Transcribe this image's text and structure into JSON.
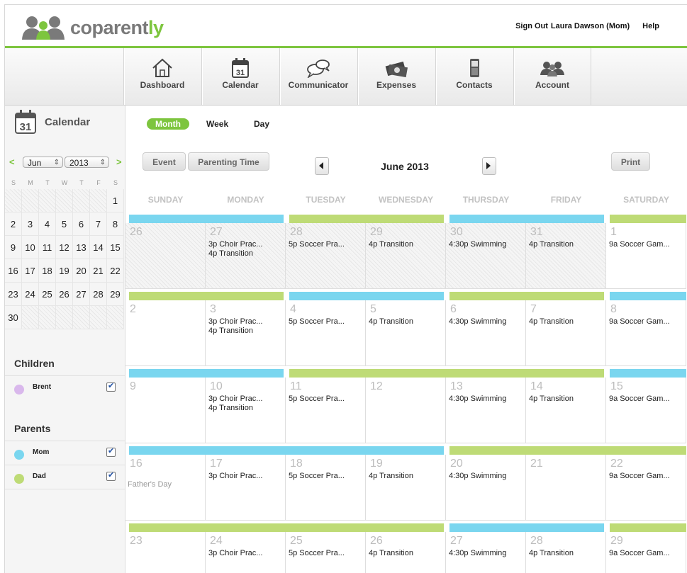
{
  "brand": {
    "name_main": "coparent",
    "name_accent": "ly",
    "colors": {
      "green": "#7dc53e",
      "blue": "#7ad6ef",
      "lime": "#bedb76",
      "purple": "#d9b8ec",
      "gray": "#7a7a7a"
    }
  },
  "header": {
    "sign_out": "Sign Out",
    "user": "Laura Dawson (Mom)",
    "help": "Help"
  },
  "nav": [
    {
      "label": "Dashboard",
      "icon": "house-icon"
    },
    {
      "label": "Calendar",
      "icon": "calendar-icon",
      "icon_text": "31"
    },
    {
      "label": "Communicator",
      "icon": "speech-bubbles-icon"
    },
    {
      "label": "Expenses",
      "icon": "money-icon"
    },
    {
      "label": "Contacts",
      "icon": "phone-icon"
    },
    {
      "label": "Account",
      "icon": "people-icon"
    }
  ],
  "sidebar": {
    "title": "Calendar",
    "icon_text": "31",
    "prev": "<",
    "next": ">",
    "month_select": "Jun",
    "year_select": "2013",
    "dow": [
      "S",
      "M",
      "T",
      "W",
      "T",
      "F",
      "S"
    ],
    "days": [
      "",
      "",
      "",
      "",
      "",
      "",
      "1",
      "2",
      "3",
      "4",
      "5",
      "6",
      "7",
      "8",
      "9",
      "10",
      "11",
      "12",
      "13",
      "14",
      "15",
      "16",
      "17",
      "18",
      "19",
      "20",
      "21",
      "22",
      "23",
      "24",
      "25",
      "26",
      "27",
      "28",
      "29",
      "30",
      "",
      "",
      "",
      "",
      "",
      ""
    ],
    "children_heading": "Children",
    "children": [
      {
        "name": "Brent",
        "color": "#d9b8ec",
        "checked": true
      }
    ],
    "parents_heading": "Parents",
    "parents": [
      {
        "name": "Mom",
        "color": "#7ad6ef",
        "checked": true
      },
      {
        "name": "Dad",
        "color": "#bedb76",
        "checked": true
      }
    ]
  },
  "calendar": {
    "tabs": [
      "Month",
      "Week",
      "Day"
    ],
    "active_tab": "Month",
    "event_button": "Event",
    "parenting_time_button": "Parenting Time",
    "print_button": "Print",
    "month_title": "June 2013",
    "days_of_week": [
      "SUNDAY",
      "MONDAY",
      "TUESDAY",
      "WEDNESDAY",
      "THURSDAY",
      "FRIDAY",
      "SATURDAY"
    ],
    "weeks": [
      {
        "bars": [
          {
            "from": 0,
            "to": 1,
            "parent": "mom"
          },
          {
            "from": 2,
            "to": 3,
            "parent": "dad"
          },
          {
            "from": 4,
            "to": 5,
            "parent": "mom"
          },
          {
            "from": 6,
            "to": 6,
            "parent": "dad"
          }
        ],
        "days": [
          {
            "num": "26",
            "outside": true,
            "events": []
          },
          {
            "num": "27",
            "outside": true,
            "events": [
              "3p Choir Prac...",
              "4p Transition"
            ]
          },
          {
            "num": "28",
            "outside": true,
            "events": [
              "5p Soccer Pra..."
            ]
          },
          {
            "num": "29",
            "outside": true,
            "events": [
              "4p Transition"
            ]
          },
          {
            "num": "30",
            "outside": true,
            "events": [
              "4:30p Swimming"
            ]
          },
          {
            "num": "31",
            "outside": true,
            "events": [
              "4p Transition"
            ]
          },
          {
            "num": "1",
            "outside": false,
            "events": [
              "9a Soccer Gam..."
            ]
          }
        ]
      },
      {
        "bars": [
          {
            "from": 0,
            "to": 1,
            "parent": "dad"
          },
          {
            "from": 2,
            "to": 3,
            "parent": "mom"
          },
          {
            "from": 4,
            "to": 5,
            "parent": "dad"
          },
          {
            "from": 6,
            "to": 6,
            "parent": "mom"
          }
        ],
        "days": [
          {
            "num": "2",
            "events": []
          },
          {
            "num": "3",
            "events": [
              "3p Choir Prac...",
              "4p Transition"
            ]
          },
          {
            "num": "4",
            "events": [
              "5p Soccer Pra..."
            ]
          },
          {
            "num": "5",
            "events": [
              "4p Transition"
            ]
          },
          {
            "num": "6",
            "events": [
              "4:30p Swimming"
            ]
          },
          {
            "num": "7",
            "events": [
              "4p Transition"
            ]
          },
          {
            "num": "8",
            "events": [
              "9a Soccer Gam..."
            ]
          }
        ]
      },
      {
        "bars": [
          {
            "from": 0,
            "to": 1,
            "parent": "mom"
          },
          {
            "from": 2,
            "to": 5,
            "parent": "dad"
          },
          {
            "from": 6,
            "to": 6,
            "parent": "mom"
          }
        ],
        "days": [
          {
            "num": "9",
            "events": []
          },
          {
            "num": "10",
            "events": [
              "3p Choir Prac...",
              "4p Transition"
            ]
          },
          {
            "num": "11",
            "events": [
              "5p Soccer Pra..."
            ]
          },
          {
            "num": "12",
            "events": []
          },
          {
            "num": "13",
            "events": [
              "4:30p Swimming"
            ]
          },
          {
            "num": "14",
            "events": [
              "4p Transition"
            ]
          },
          {
            "num": "15",
            "events": [
              "9a Soccer Gam..."
            ]
          }
        ]
      },
      {
        "bars": [
          {
            "from": 0,
            "to": 3,
            "parent": "mom"
          },
          {
            "from": 4,
            "to": 6,
            "parent": "dad"
          }
        ],
        "days": [
          {
            "num": "16",
            "holiday": "Father's Day",
            "events": []
          },
          {
            "num": "17",
            "events": [
              "3p Choir Prac..."
            ]
          },
          {
            "num": "18",
            "events": [
              "5p Soccer Pra..."
            ]
          },
          {
            "num": "19",
            "events": [
              "4p Transition"
            ]
          },
          {
            "num": "20",
            "events": [
              "4:30p Swimming"
            ]
          },
          {
            "num": "21",
            "events": []
          },
          {
            "num": "22",
            "events": [
              "9a Soccer Gam..."
            ]
          }
        ]
      },
      {
        "bars": [
          {
            "from": 0,
            "to": 3,
            "parent": "dad"
          },
          {
            "from": 4,
            "to": 5,
            "parent": "mom"
          },
          {
            "from": 6,
            "to": 6,
            "parent": "dad"
          }
        ],
        "days": [
          {
            "num": "23",
            "events": []
          },
          {
            "num": "24",
            "events": [
              "3p Choir Prac..."
            ]
          },
          {
            "num": "25",
            "events": [
              "5p Soccer Pra..."
            ]
          },
          {
            "num": "26",
            "events": [
              "4p Transition"
            ]
          },
          {
            "num": "27",
            "events": [
              "4:30p Swimming"
            ]
          },
          {
            "num": "28",
            "events": [
              "4p Transition"
            ]
          },
          {
            "num": "29",
            "events": [
              "9a Soccer Gam..."
            ]
          }
        ]
      }
    ]
  }
}
